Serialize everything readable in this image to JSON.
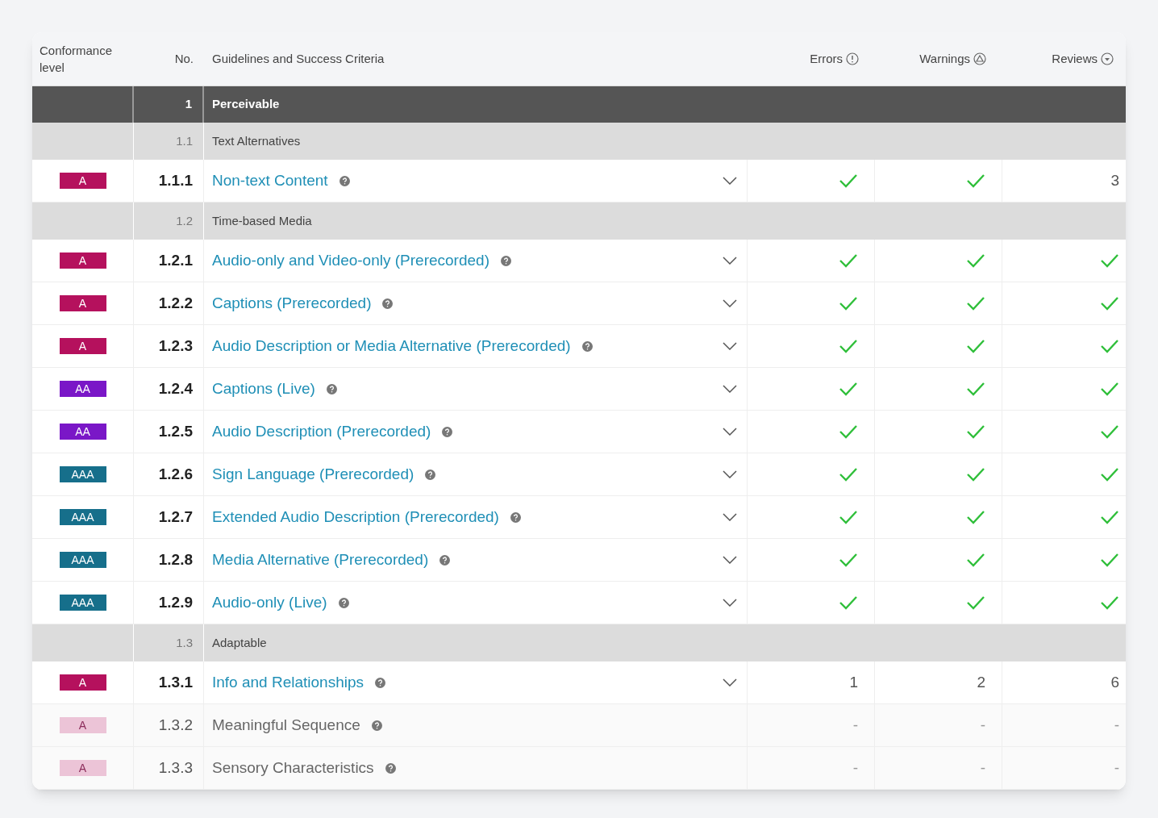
{
  "columns": {
    "level": "Conformance level",
    "number": "No.",
    "criteria": "Guidelines and Success Criteria",
    "errors": "Errors",
    "warnings": "Warnings",
    "reviews": "Reviews"
  },
  "rows": [
    {
      "kind": "principle",
      "number": "1",
      "title": "Perceivable"
    },
    {
      "kind": "guideline",
      "number": "1.1",
      "title": "Text Alternatives"
    },
    {
      "kind": "criterion",
      "level": "A",
      "disabled": false,
      "number": "1.1.1",
      "title": "Non-text Content",
      "results": [
        {
          "kind": "check"
        },
        {
          "kind": "check"
        },
        {
          "kind": "count",
          "text": "3"
        }
      ]
    },
    {
      "kind": "guideline",
      "number": "1.2",
      "title": "Time-based Media"
    },
    {
      "kind": "criterion",
      "level": "A",
      "disabled": false,
      "number": "1.2.1",
      "title": "Audio-only and Video-only (Prerecorded)",
      "results": [
        {
          "kind": "check"
        },
        {
          "kind": "check"
        },
        {
          "kind": "check"
        }
      ]
    },
    {
      "kind": "criterion",
      "level": "A",
      "disabled": false,
      "number": "1.2.2",
      "title": "Captions (Prerecorded)",
      "results": [
        {
          "kind": "check"
        },
        {
          "kind": "check"
        },
        {
          "kind": "check"
        }
      ]
    },
    {
      "kind": "criterion",
      "level": "A",
      "disabled": false,
      "number": "1.2.3",
      "title": "Audio Description or Media Alternative (Prerecorded)",
      "results": [
        {
          "kind": "check"
        },
        {
          "kind": "check"
        },
        {
          "kind": "check"
        }
      ]
    },
    {
      "kind": "criterion",
      "level": "AA",
      "disabled": false,
      "number": "1.2.4",
      "title": "Captions (Live)",
      "results": [
        {
          "kind": "check"
        },
        {
          "kind": "check"
        },
        {
          "kind": "check"
        }
      ]
    },
    {
      "kind": "criterion",
      "level": "AA",
      "disabled": false,
      "number": "1.2.5",
      "title": "Audio Description (Prerecorded)",
      "results": [
        {
          "kind": "check"
        },
        {
          "kind": "check"
        },
        {
          "kind": "check"
        }
      ]
    },
    {
      "kind": "criterion",
      "level": "AAA",
      "disabled": false,
      "number": "1.2.6",
      "title": "Sign Language (Prerecorded)",
      "results": [
        {
          "kind": "check"
        },
        {
          "kind": "check"
        },
        {
          "kind": "check"
        }
      ]
    },
    {
      "kind": "criterion",
      "level": "AAA",
      "disabled": false,
      "number": "1.2.7",
      "title": "Extended Audio Description (Prerecorded)",
      "results": [
        {
          "kind": "check"
        },
        {
          "kind": "check"
        },
        {
          "kind": "check"
        }
      ]
    },
    {
      "kind": "criterion",
      "level": "AAA",
      "disabled": false,
      "number": "1.2.8",
      "title": "Media Alternative (Prerecorded)",
      "results": [
        {
          "kind": "check"
        },
        {
          "kind": "check"
        },
        {
          "kind": "check"
        }
      ]
    },
    {
      "kind": "criterion",
      "level": "AAA",
      "disabled": false,
      "number": "1.2.9",
      "title": "Audio-only (Live)",
      "results": [
        {
          "kind": "check"
        },
        {
          "kind": "check"
        },
        {
          "kind": "check"
        }
      ]
    },
    {
      "kind": "guideline",
      "number": "1.3",
      "title": "Adaptable"
    },
    {
      "kind": "criterion",
      "level": "A",
      "disabled": false,
      "number": "1.3.1",
      "title": "Info and Relationships",
      "results": [
        {
          "kind": "count",
          "text": "1"
        },
        {
          "kind": "count",
          "text": "2"
        },
        {
          "kind": "count",
          "text": "6"
        }
      ]
    },
    {
      "kind": "criterion",
      "level": "A",
      "disabled": true,
      "number": "1.3.2",
      "title": "Meaningful Sequence",
      "results": [
        {
          "kind": "count",
          "text": "-"
        },
        {
          "kind": "count",
          "text": "-"
        },
        {
          "kind": "count",
          "text": "-"
        }
      ]
    },
    {
      "kind": "criterion",
      "level": "A",
      "disabled": true,
      "number": "1.3.3",
      "title": "Sensory Characteristics",
      "results": [
        {
          "kind": "count",
          "text": "-"
        },
        {
          "kind": "count",
          "text": "-"
        },
        {
          "kind": "count",
          "text": "-"
        }
      ]
    }
  ]
}
